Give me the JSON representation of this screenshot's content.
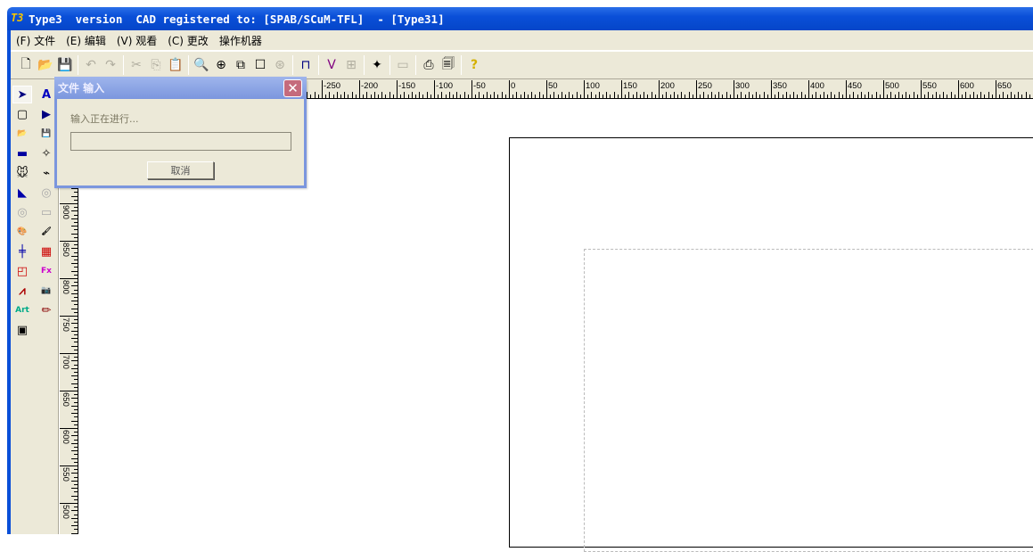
{
  "window": {
    "title": "Type3  version  CAD registered to: [SPAB/SCuM-TFL]  - [Type31]",
    "app_icon": "T3"
  },
  "menu": [
    {
      "label": "(F) 文件"
    },
    {
      "label": "(E) 编辑"
    },
    {
      "label": "(V) 观看"
    },
    {
      "label": "(C) 更改"
    },
    {
      "label": "操作机器"
    }
  ],
  "toolbar": {
    "icons": [
      "new-file-icon",
      "open-folder-icon",
      "save-icon",
      "|",
      "undo-icon",
      "redo-icon",
      "|",
      "cut-icon",
      "copy-icon",
      "paste-icon",
      "|",
      "zoom-icon",
      "zoom-in-icon",
      "zoom-window-icon",
      "page-icon",
      "zoom-fit-icon",
      "|",
      "measure-icon",
      "|",
      "vectorize-icon",
      "text-grid-icon",
      "|",
      "magic-wand-icon",
      "|",
      "image-icon",
      "|",
      "print-icon",
      "print-preview-icon",
      "|",
      "help-icon"
    ]
  },
  "dialog": {
    "title": "文件 输入",
    "message": "输入正在进行...",
    "progress": 0,
    "cancel_label": "取消"
  },
  "rulers": {
    "horizontal_labels": [
      "-250",
      "-200",
      "-150",
      "-100",
      "-50",
      "0",
      "50",
      "100",
      "150",
      "200",
      "250",
      "300",
      "350",
      "400",
      "450",
      "500",
      "550",
      "600",
      "650"
    ],
    "vertical_labels": [
      "900",
      "850",
      "800",
      "750",
      "700",
      "650",
      "600",
      "550",
      "500"
    ]
  },
  "colors": {
    "titlebar": "#0a4fd8",
    "chrome": "#ece9d8"
  }
}
